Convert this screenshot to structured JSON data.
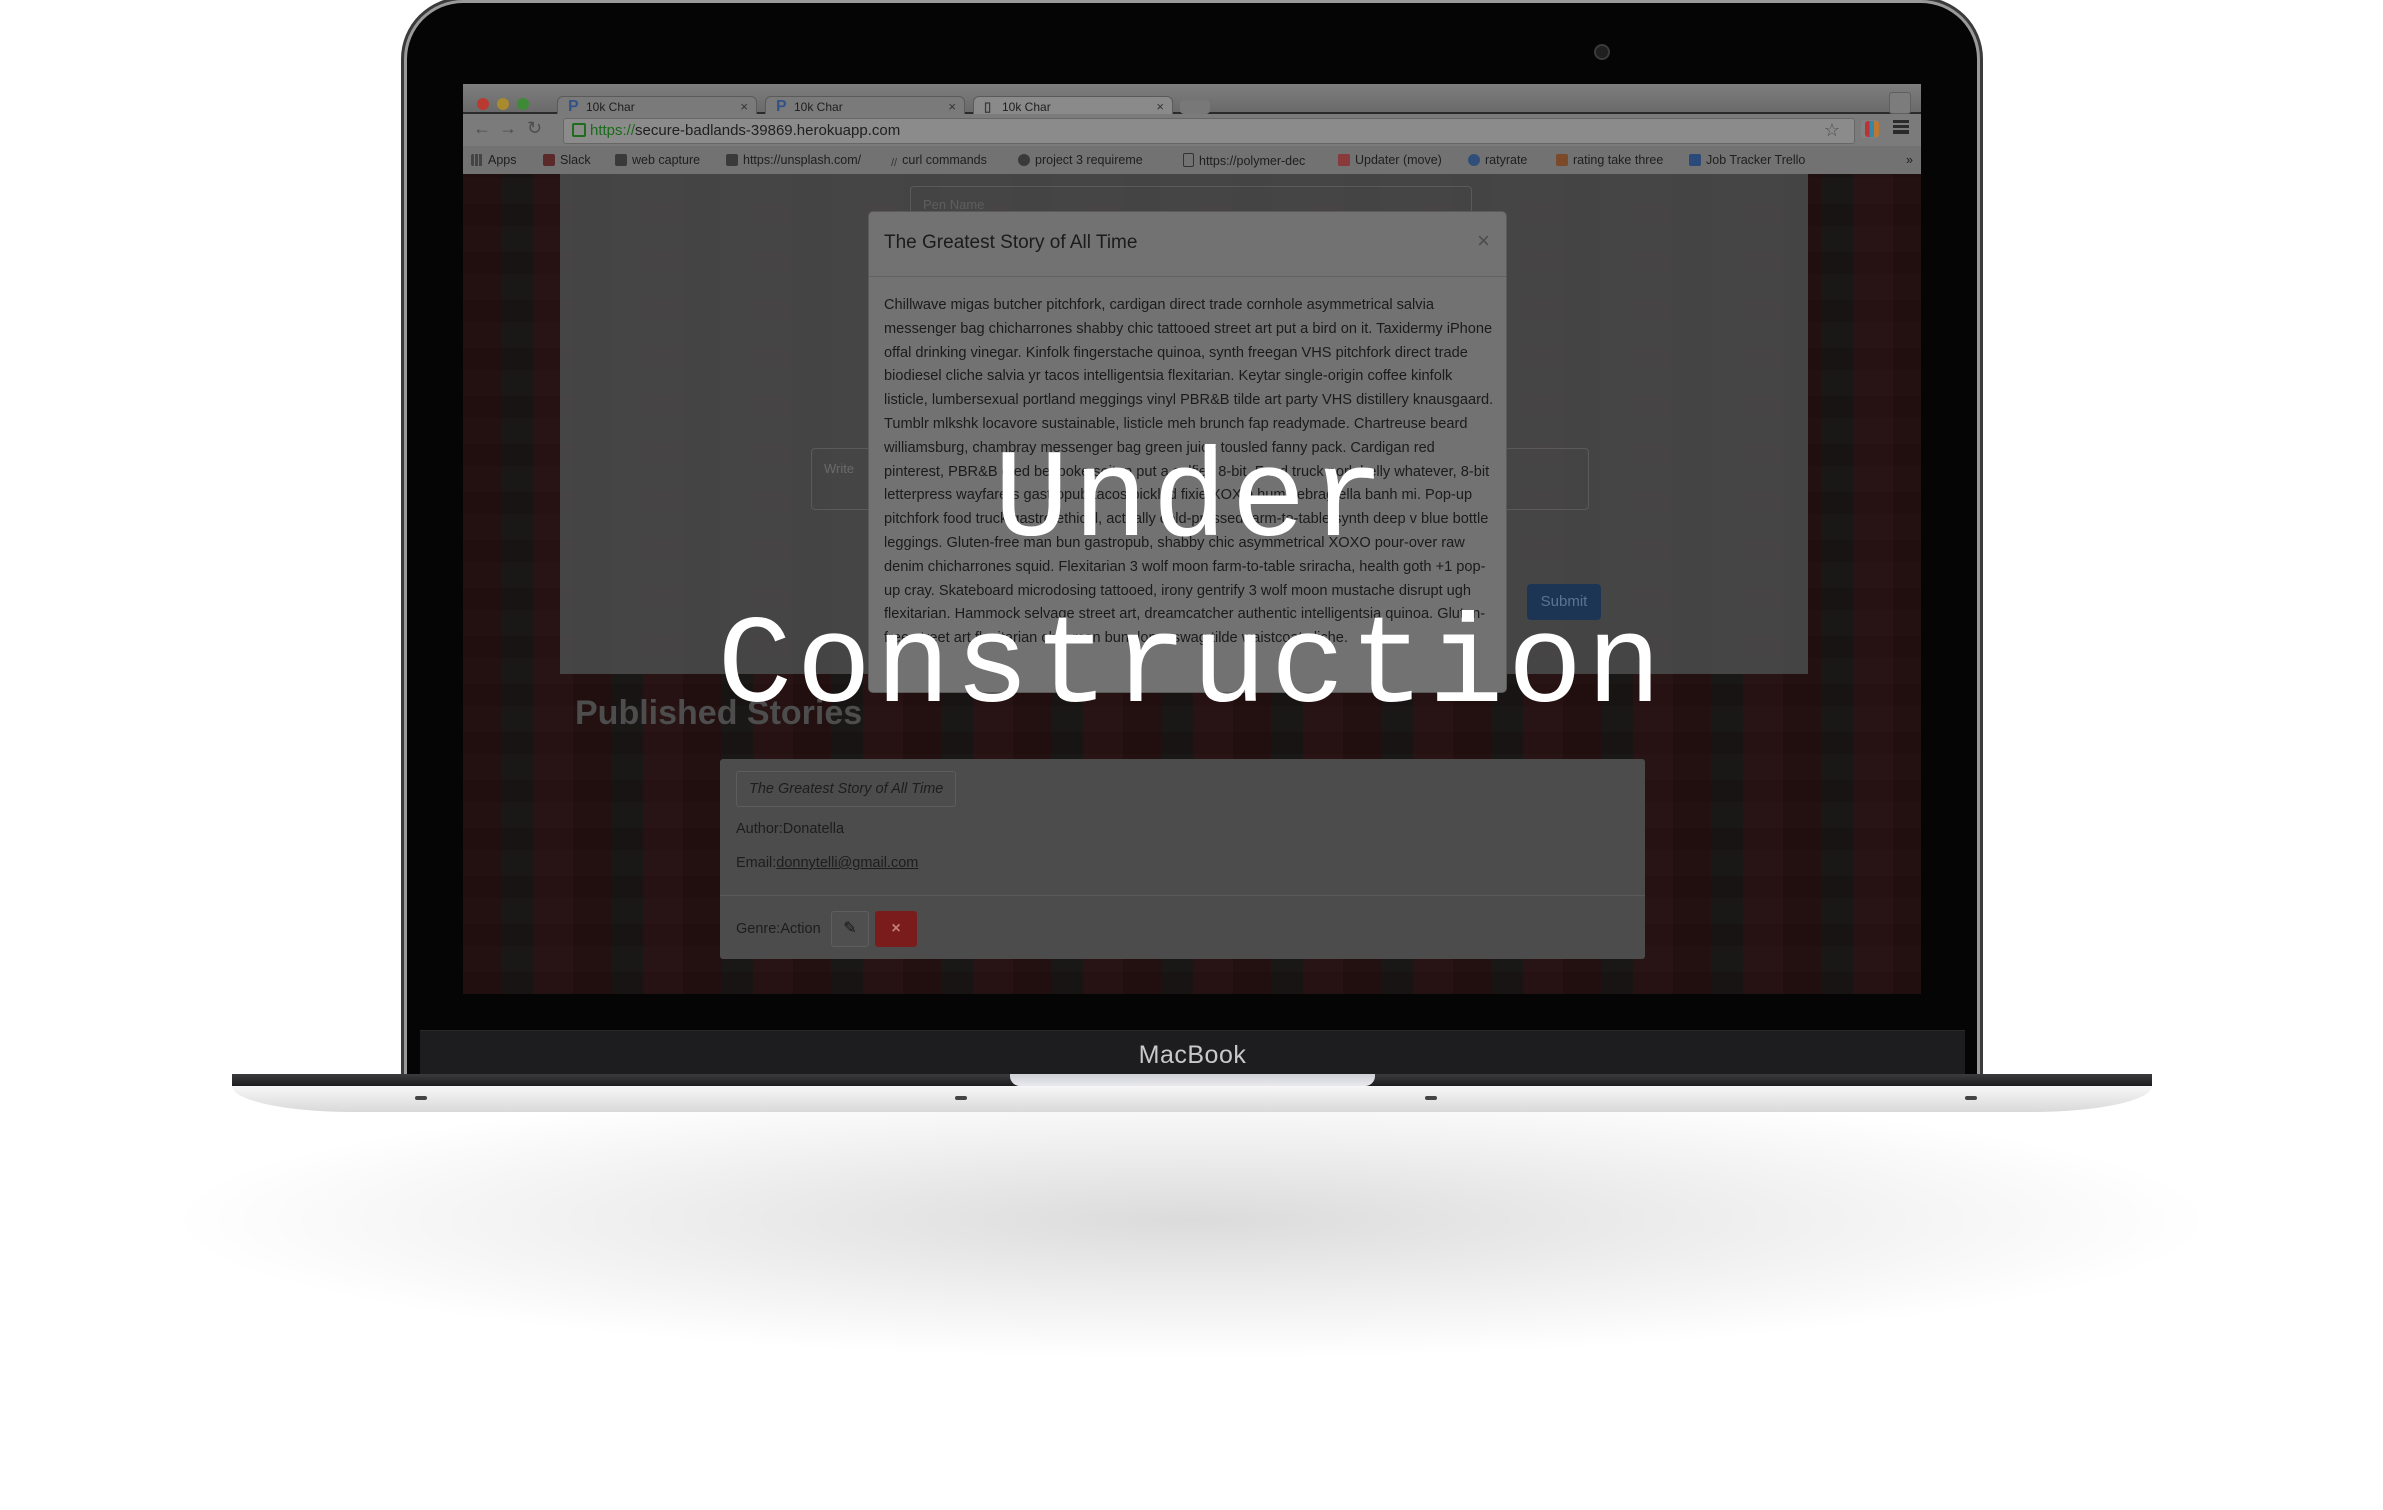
{
  "device": {
    "brand": "MacBook"
  },
  "browser": {
    "tabs": [
      {
        "label": "10k Char",
        "favicon": "P"
      },
      {
        "label": "10k Char",
        "favicon": "P"
      },
      {
        "label": "10k Char",
        "favicon": "doc"
      }
    ],
    "address": {
      "scheme": "https://",
      "host": "secure-badlands-39869.herokuapp.com"
    },
    "bookmarks": [
      "Apps",
      "Slack",
      "web capture",
      "https://unsplash.com/",
      "curl commands",
      "project 3 requireme",
      "https://polymer-dec",
      "Updater (move)",
      "ratyrate",
      "rating take three",
      "Job Tracker Trello"
    ]
  },
  "form": {
    "name_placeholder": "Pen Name",
    "story_placeholder": "Write",
    "submit_label": "Submit"
  },
  "modal": {
    "title": "The Greatest Story of All Time",
    "close": "×",
    "body": "Chillwave migas butcher pitchfork, cardigan direct trade cornhole asymmetrical salvia messenger bag chicharrones shabby chic tattooed street art put a bird on it. Taxidermy iPhone offal drinking vinegar. Kinfolk fingerstache quinoa, synth freegan VHS pitchfork direct trade biodiesel cliche salvia yr tacos intelligentsia flexitarian. Keytar single-origin coffee kinfolk listicle, lumbersexual portland meggings vinyl PBR&B tilde art party VHS distillery knausgaard. Tumblr mlkshk locavore sustainable, listicle meh brunch fap readymade. Chartreuse beard williamsburg, chambray messenger bag green juice tousled fanny pack. Cardigan red pinterest, PBR&B cred bespoke seitan put a selfies 8-bit. Food truck pork belly whatever, 8-bit letterpress wayfarers gastropub tacos pickled fixie XOXO humblebrag ella banh mi. Pop-up pitchfork food truck gastro ethical, actually cold-pressed farm-to-table synth deep v blue bottle leggings. Gluten-free man bun gastropub, shabby chic asymmetrical XOXO pour-over raw denim chicharrones squid. Flexitarian 3 wolf moon farm-to-table sriracha, health goth +1 pop-up cray. Skateboard microdosing tattooed, irony gentrify 3 wolf moon mustache disrupt ugh flexitarian. Hammock selvage street art, dreamcatcher authentic intelligentsia quinoa. Gluten-free street art flexitarian chia man bun, lomo swag tilde waistcoat cliche."
  },
  "published": {
    "heading": "Published Stories",
    "story": {
      "title": "The Greatest Story of All Time",
      "author_label": "Author:",
      "author": "Donatella",
      "email_label": "Email:",
      "email": "donnytelli@gmail.com",
      "genre_label": "Genre:",
      "genre": "Action",
      "delete_icon": "×"
    }
  },
  "overlay": {
    "line1": "Under",
    "line2": "Construction"
  }
}
